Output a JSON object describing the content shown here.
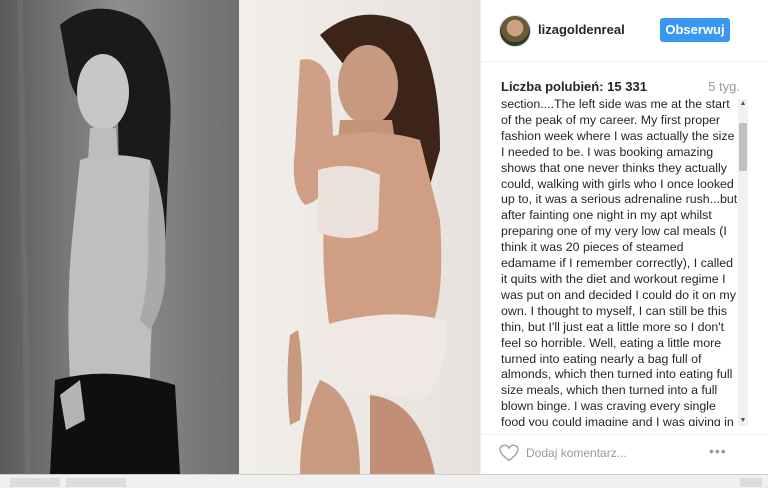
{
  "post": {
    "username": "lizagoldenreal",
    "follow_label": "Obserwuj",
    "likes": "Liczba polubień: 15 331",
    "age": "5 tyg.",
    "caption": "section....The left side was me at the start of the peak of my career. My first proper fashion week where I was actually the size I needed to be. I was booking amazing shows that one never thinks they actually could, walking with girls who I once looked up to, it was a serious adrenaline rush...but after fainting one night in my apt whilst preparing one of my very low cal meals (I think it was 20 pieces of steamed edamame if I remember correctly), I called it quits with the diet and workout regime I was put on and decided I could do it on my own. I thought to myself, I can still be this thin, but I'll just eat a little more so I don't feel so horrible. Well, eating a little more turned into eating nearly a bag full of almonds, which then turned into eating full size meals, which then turned into a full blown binge. I was craving every single food you could imagine and I was giving in to every craving even though I",
    "comment_placeholder": "Dodaj komentarz...",
    "more_label": "•••"
  },
  "icons": {
    "avatar": "profile-avatar",
    "like": "heart-outline-icon",
    "options": "ellipsis-icon"
  },
  "colors": {
    "accent": "#3897f0",
    "text": "#262626",
    "muted": "#999999"
  }
}
